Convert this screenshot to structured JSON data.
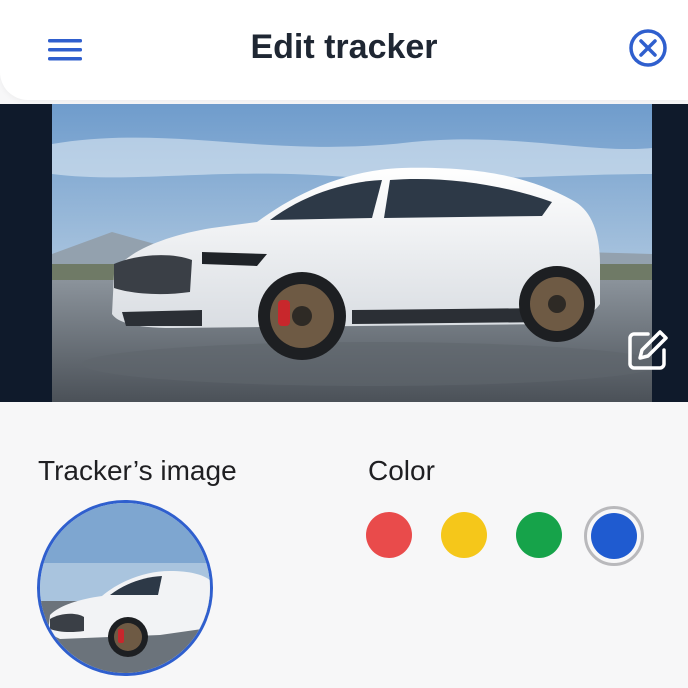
{
  "header": {
    "title": "Edit tracker",
    "menu_icon": "hamburger-menu-icon",
    "close_icon": "close-circle-icon"
  },
  "hero": {
    "edit_icon": "edit-pencil-icon"
  },
  "tracker_image": {
    "label": "Tracker’s image"
  },
  "color": {
    "label": "Color",
    "options": [
      {
        "name": "red",
        "hex": "#e94b4b"
      },
      {
        "name": "yellow",
        "hex": "#f5c71a"
      },
      {
        "name": "green",
        "hex": "#16a34a"
      },
      {
        "name": "blue",
        "hex": "#1f5bd0",
        "selected": true
      }
    ]
  },
  "colors": {
    "accent": "#2f5fce",
    "text": "#1f2733"
  }
}
